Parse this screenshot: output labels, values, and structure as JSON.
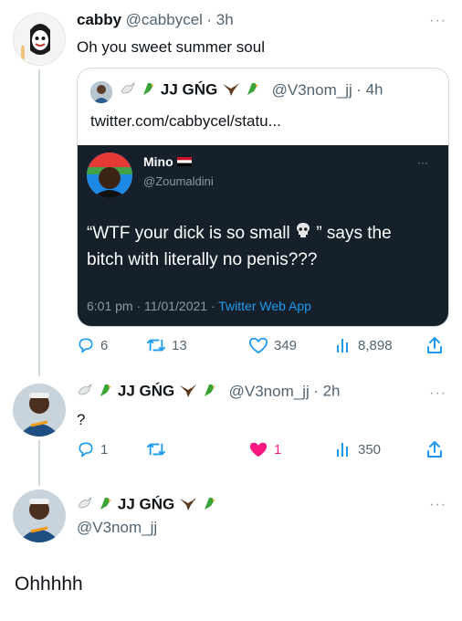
{
  "tweet1": {
    "name": "cabby",
    "handle": "@cabbycel",
    "time": "· 3h",
    "text": "Oh you sweet summer soul",
    "more": "···"
  },
  "quote": {
    "name": "JJ GŃG",
    "handle": "@V3nom_jj",
    "time": "· 4h",
    "link": "twitter.com/cabbycel/statu...",
    "inner": {
      "name": "Mino",
      "handle": "@Zoumaldini",
      "text_line1": "“WTF your dick is so small",
      "text_line1_end": "” says the",
      "text_line2": "bitch with literally no penis???",
      "time": "6:01 pm · 11/01/2021 ·",
      "source": "Twitter Web App",
      "more": "···"
    }
  },
  "tweet1_actions": {
    "replies": "6",
    "retweets": "13",
    "likes": "349",
    "views": "8,898"
  },
  "tweet2": {
    "name": "JJ GŃG",
    "handle": "@V3nom_jj",
    "time": "· 2h",
    "text": "?",
    "more": "···"
  },
  "tweet2_actions": {
    "replies": "1",
    "retweets": "",
    "likes": "1",
    "views": "350"
  },
  "tweet3": {
    "name": "JJ GŃG",
    "handle": "@V3nom_jj",
    "text": "Ohhhhh",
    "more": "···"
  },
  "colors": {
    "like_active": "#f91880",
    "link_blue": "#1d9bf0",
    "secondary": "#536471"
  }
}
